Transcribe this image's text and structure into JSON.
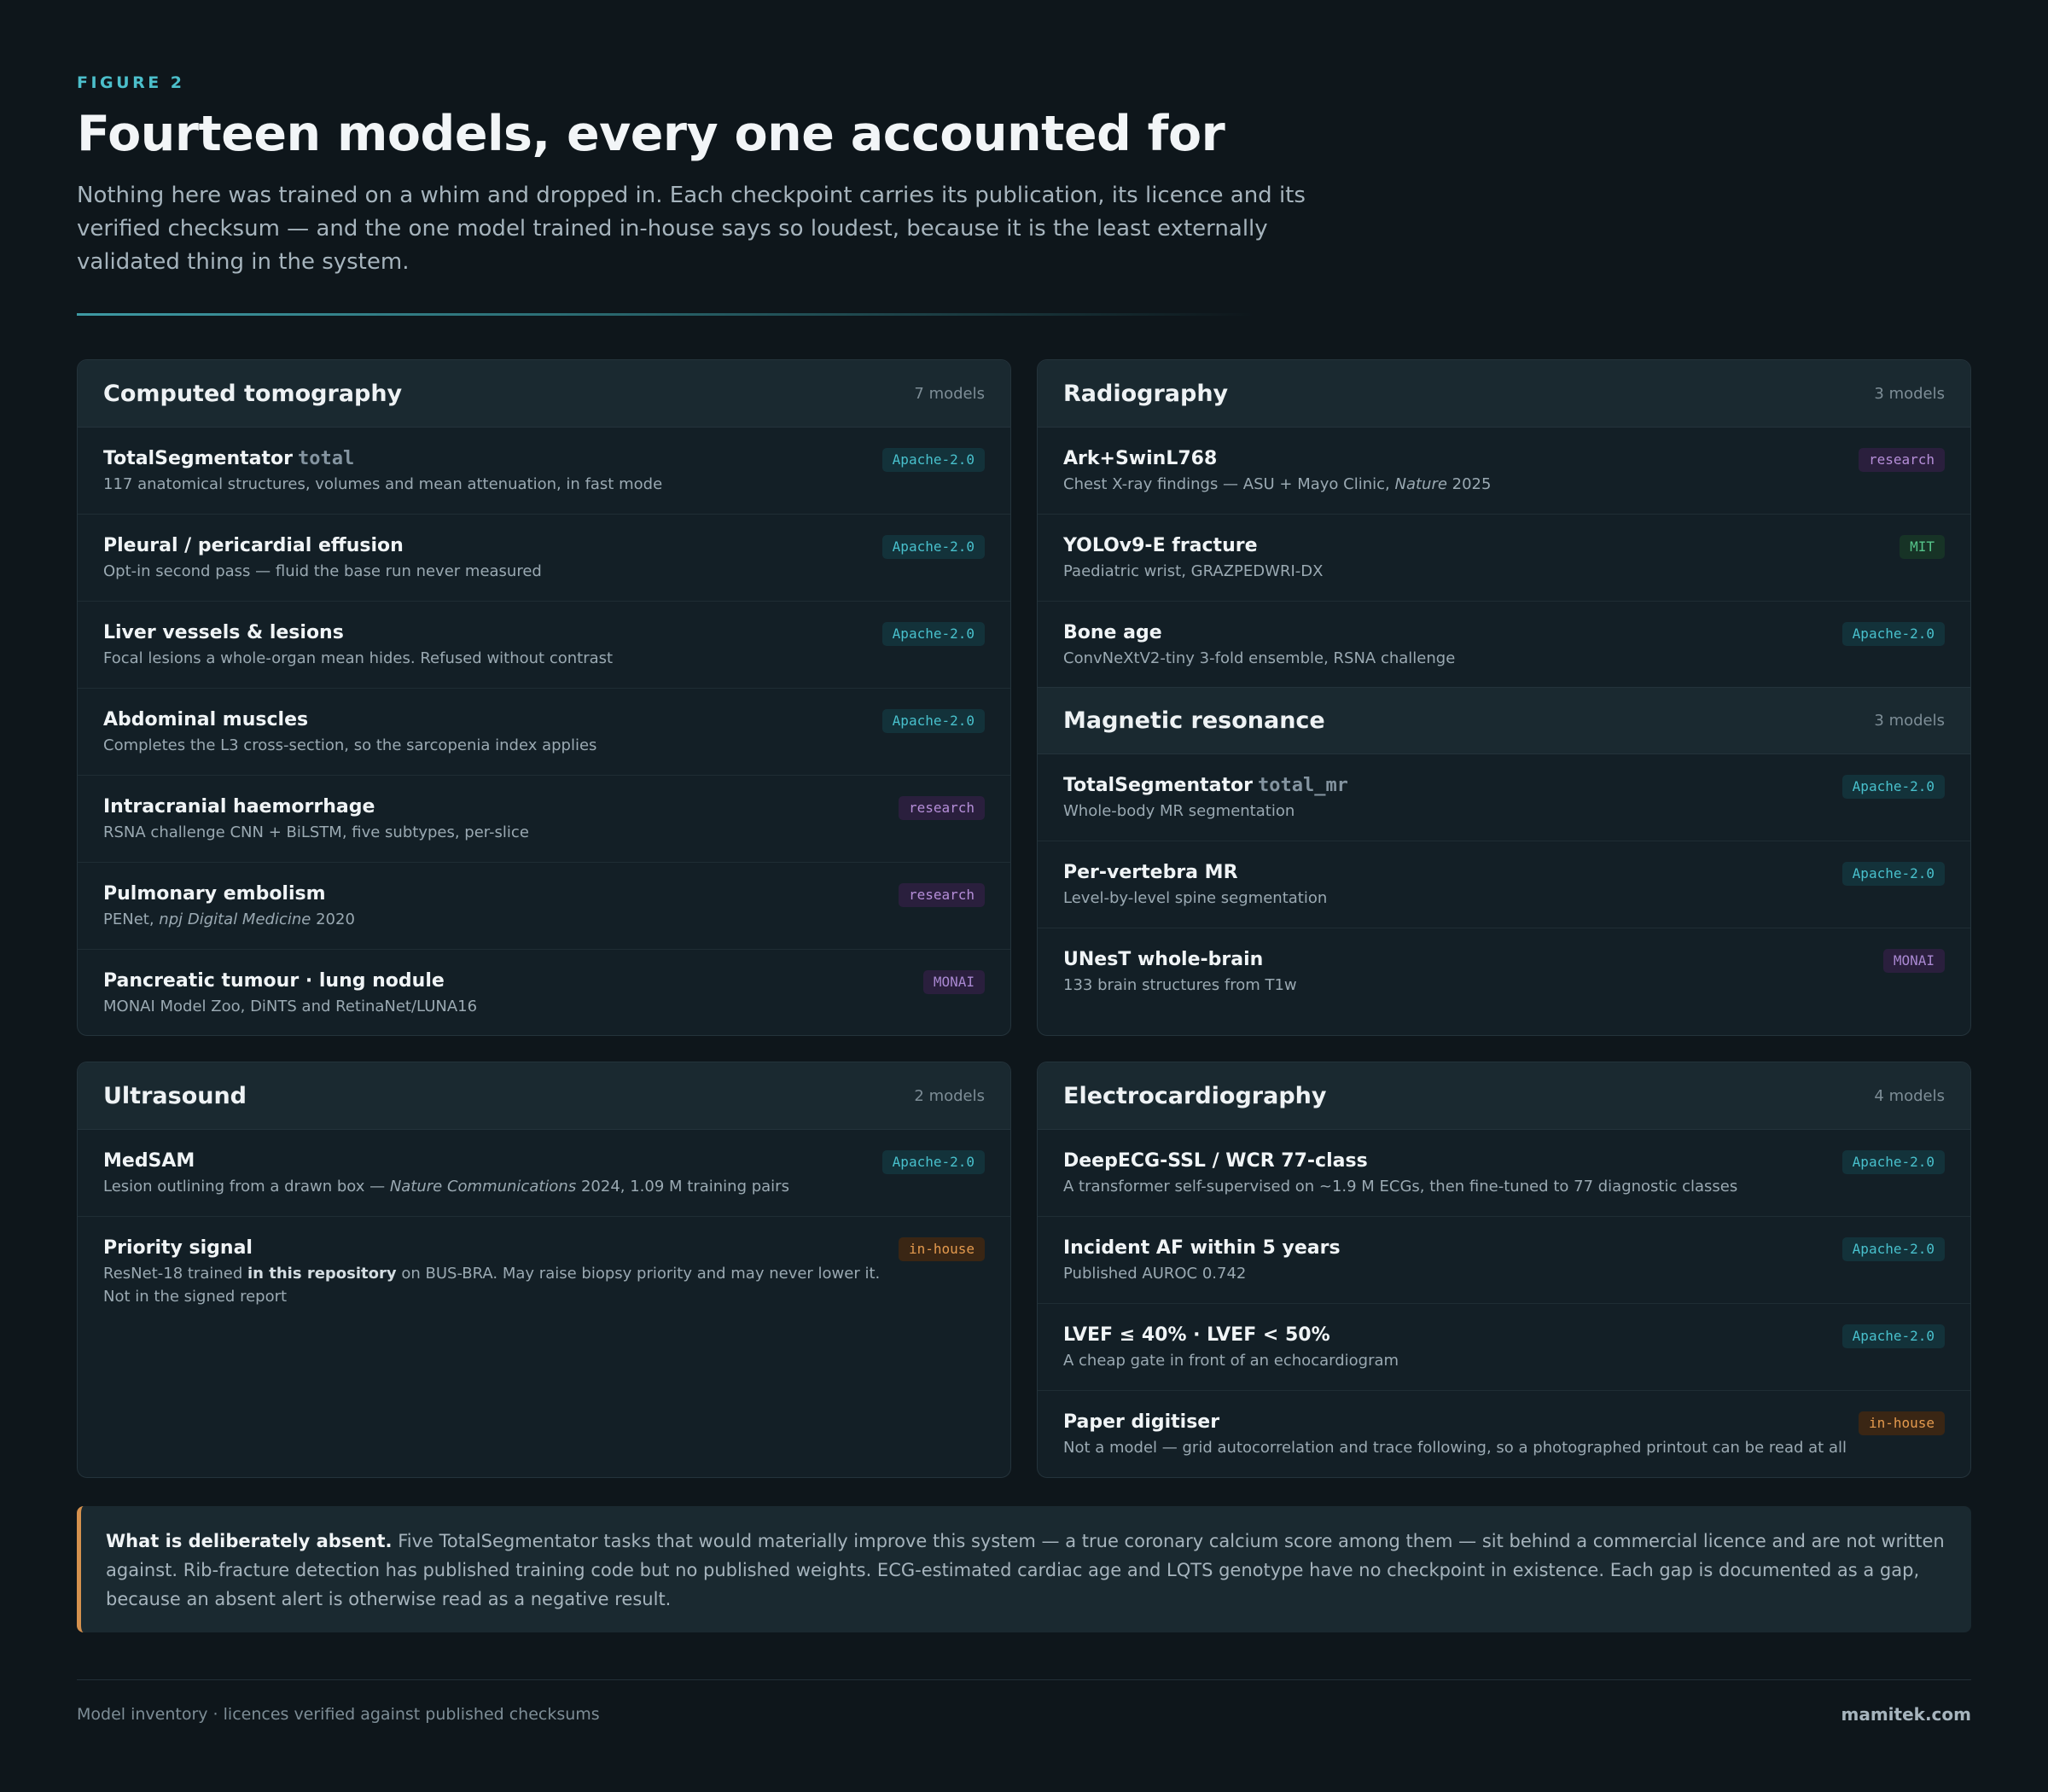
{
  "header": {
    "eyebrow": "FIGURE 2",
    "title": "Fourteen models, every one accounted for",
    "lede": "Nothing here was trained on a whim and dropped in. Each checkpoint carries its publication, its licence and its verified checksum — and the one model trained in-house says so loudest, because it is the least externally validated thing in the system."
  },
  "ct": {
    "title": "Computed tomography",
    "count": "7 models",
    "rows": [
      {
        "name": "TotalSegmentator",
        "code": "total",
        "desc": "117 anatomical structures, volumes and mean attenuation, in fast mode",
        "badge": "Apache-2.0"
      },
      {
        "name": "Pleural / pericardial effusion",
        "desc": "Opt-in second pass — fluid the base run never measured",
        "badge": "Apache-2.0"
      },
      {
        "name": "Liver vessels & lesions",
        "desc": "Focal lesions a whole-organ mean hides. Refused without contrast",
        "badge": "Apache-2.0"
      },
      {
        "name": "Abdominal muscles",
        "desc": "Completes the L3 cross-section, so the sarcopenia index applies",
        "badge": "Apache-2.0"
      },
      {
        "name": "Intracranial haemorrhage",
        "desc": "RSNA challenge CNN + BiLSTM, five subtypes, per-slice",
        "badge": "research"
      },
      {
        "name": "Pulmonary embolism",
        "desc_a": "PENet, ",
        "desc_i": "npj Digital Medicine",
        "desc_b": " 2020",
        "badge": "research"
      },
      {
        "name": "Pancreatic tumour · lung nodule",
        "desc": "MONAI Model Zoo, DiNTS and RetinaNet/LUNA16",
        "badge": "MONAI"
      }
    ]
  },
  "xr": {
    "title": "Radiography",
    "count": "3 models",
    "rows": [
      {
        "name": "Ark+SwinL768",
        "desc_a": "Chest X-ray findings — ASU + Mayo Clinic, ",
        "desc_i": "Nature",
        "desc_b": " 2025",
        "badge": "research"
      },
      {
        "name": "YOLOv9-E fracture",
        "desc": "Paediatric wrist, GRAZPEDWRI-DX",
        "badge": "MIT"
      },
      {
        "name": "Bone age",
        "desc": "ConvNeXtV2-tiny 3-fold ensemble, RSNA challenge",
        "badge": "Apache-2.0"
      }
    ]
  },
  "mr": {
    "title": "Magnetic resonance",
    "count": "3 models",
    "rows": [
      {
        "name": "TotalSegmentator",
        "code": "total_mr",
        "desc": "Whole-body MR segmentation",
        "badge": "Apache-2.0"
      },
      {
        "name": "Per-vertebra MR",
        "desc": "Level-by-level spine segmentation",
        "badge": "Apache-2.0"
      },
      {
        "name": "UNesT whole-brain",
        "desc": "133 brain structures from T1w",
        "badge": "MONAI"
      }
    ]
  },
  "us": {
    "title": "Ultrasound",
    "count": "2 models",
    "rows": [
      {
        "name": "MedSAM",
        "desc_a": "Lesion outlining from a drawn box — ",
        "desc_i": "Nature Communications",
        "desc_b": " 2024, 1.09 M training pairs",
        "badge": "Apache-2.0"
      },
      {
        "name": "Priority signal",
        "desc_a": "ResNet-18 trained ",
        "desc_bold": "in this repository",
        "desc_b": " on BUS-BRA. May raise biopsy priority and may never lower it. Not in the signed report",
        "badge": "in-house"
      }
    ]
  },
  "ecg": {
    "title": "Electrocardiography",
    "count": "4 models",
    "rows": [
      {
        "name": "DeepECG-SSL / WCR 77-class",
        "desc": "A transformer self-supervised on ~1.9 M ECGs, then fine-tuned to 77 diagnostic classes",
        "badge": "Apache-2.0"
      },
      {
        "name": "Incident AF within 5 years",
        "desc": "Published AUROC 0.742",
        "badge": "Apache-2.0"
      },
      {
        "name": "LVEF ≤ 40% · LVEF < 50%",
        "desc": "A cheap gate in front of an echocardiogram",
        "badge": "Apache-2.0"
      },
      {
        "name": "Paper digitiser",
        "desc": "Not a model — grid autocorrelation and trace following, so a photographed printout can be read at all",
        "badge": "in-house"
      }
    ]
  },
  "callout": {
    "lead": "What is deliberately absent.",
    "body": " Five TotalSegmentator tasks that would materially improve this system — a true coronary calcium score among them — sit behind a commercial licence and are not written against. Rib-fracture detection has published training code but no published weights. ECG-estimated cardiac age and LQTS genotype have no checkpoint in existence. Each gap is documented as a gap, because an absent alert is otherwise read as a negative result."
  },
  "footer": {
    "left": "Model inventory · licences verified against published checksums",
    "right": "mamitek.com"
  }
}
